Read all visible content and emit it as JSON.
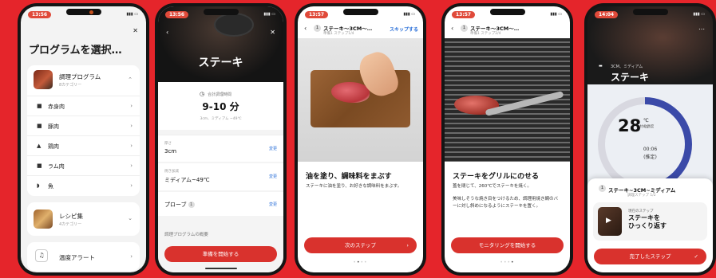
{
  "colors": {
    "background": "#e5252b",
    "accent": "#d9322d",
    "link": "#2a6fd8",
    "ring": "#3b4aa8"
  },
  "screen1": {
    "time": "13:56",
    "title": "プログラムを選択…",
    "cooking_programs": {
      "label": "調理プログラム",
      "count": "8カテゴリー"
    },
    "categories": [
      {
        "icon": "cow-icon",
        "label": "赤身肉"
      },
      {
        "icon": "pig-icon",
        "label": "豚肉"
      },
      {
        "icon": "chicken-icon",
        "label": "鶏肉"
      },
      {
        "icon": "lamb-icon",
        "label": "ラム肉"
      },
      {
        "icon": "fish-icon",
        "label": "魚"
      }
    ],
    "recipes": {
      "label": "レシピ集",
      "count": "4カテゴリー"
    },
    "alert": {
      "label": "温度アラート"
    }
  },
  "screen2": {
    "time": "13:56",
    "title": "ステーキ",
    "total_label": "合計調理時間",
    "total_time": "9-10 分",
    "total_sub": "3cm、ミディアム ~49℃",
    "thickness_label": "厚さ",
    "thickness_value": "3cm",
    "doneness_label": "焼き加減",
    "doneness_value": "ミディアム~49℃",
    "probe_label": "プローブ",
    "probe_num": "1",
    "edit_label": "変更",
    "overview_label": "調理プログラムの概要",
    "start_button": "準備を開始する"
  },
  "screen3": {
    "time": "13:57",
    "step_num": "1",
    "header_title": "ステーキ～3CM～…",
    "header_sub": "準備1 ステップ1/4",
    "skip": "スキップする",
    "step_title": "油を塗り、調味料をまぶす",
    "step_desc": "ステーキに油を塗り、お好きな調味料をまぶす。",
    "next_button": "次のステップ"
  },
  "screen4": {
    "time": "13:57",
    "step_num": "1",
    "header_title": "ステーキ～3CM～…",
    "header_sub": "準備1 ステップ2/4",
    "step_title": "ステーキをグリルにのせる",
    "step_desc1": "蓋を閉じて、260℃でステーキを焼く。",
    "step_desc2": "美味しそうな焼き目をつけるため、調理用焼き網のバーに対し斜めになるようにステーキを置く。",
    "monitor_button": "モニタリングを開始する"
  },
  "screen5": {
    "time": "14:04",
    "subtitle": "3CM、ミディアム",
    "title": "ステーキ",
    "ring_label": "食材の温度",
    "temp": "28",
    "temp_unit": "℃",
    "temp_target": "49°",
    "ring_time": "00:06",
    "ring_time_sub": "(推定)",
    "ring_progress": 0.42,
    "step_num": "1",
    "sheet_title": "ステーキ~3CM~ミディアム",
    "sheet_sub": "調理ステップ 1/2",
    "current_label": "現在のステップ",
    "current_title": "ステーキを\nひっくり返す",
    "done_button": "完了したステップ"
  }
}
